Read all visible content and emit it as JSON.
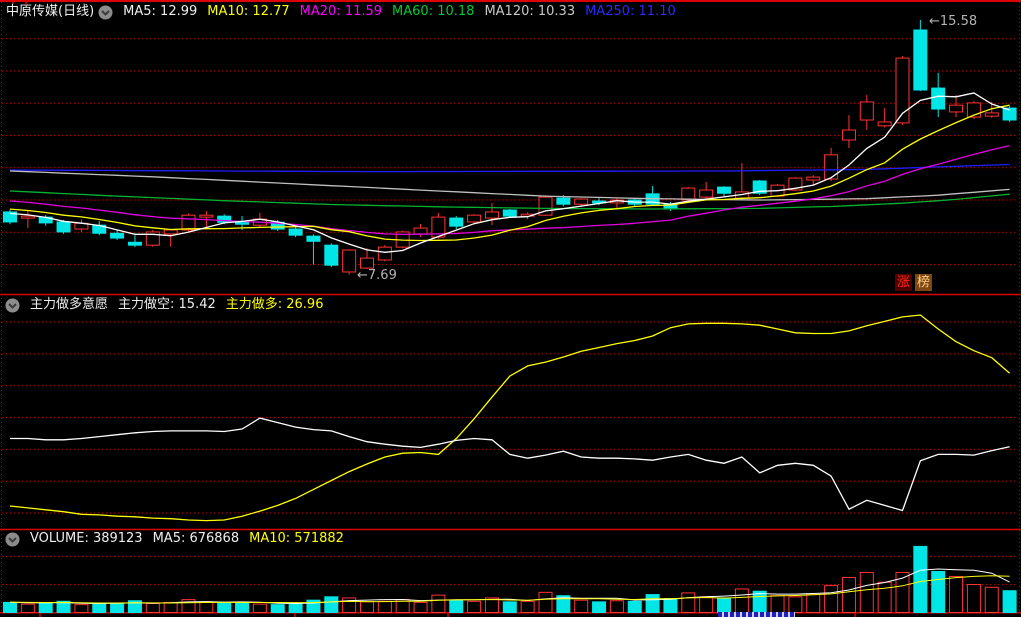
{
  "header": {
    "title": "中原传媒(日线)",
    "ma_items": [
      {
        "text": "MA5: 12.99",
        "color": "#eeeeee"
      },
      {
        "text": "MA10: 12.77",
        "color": "#ffff00"
      },
      {
        "text": "MA20: 11.59",
        "color": "#ff00ff"
      },
      {
        "text": "MA60: 10.18",
        "color": "#00c838"
      },
      {
        "text": "MA120: 10.33",
        "color": "#c8c8c8"
      },
      {
        "text": "MA250: 11.10",
        "color": "#2b2bff"
      }
    ]
  },
  "indicator_header": {
    "title": "主力做多意愿",
    "kong_text": "主力做空: 15.42",
    "duo_text": "主力做多: 26.96"
  },
  "volume_header": {
    "vol_text": "VOLUME: 389123",
    "ma5_text": "MA5: 676868",
    "ma10_text": "MA10: 571882"
  },
  "badges": [
    {
      "label": "涨",
      "bg": "#500000",
      "fg": "#ff2814"
    },
    {
      "label": "榜",
      "bg": "#7d4612",
      "fg": "#ffcc80"
    }
  ],
  "annotations": {
    "high_text": "←15.58",
    "low_text": "←7.69"
  },
  "colors": {
    "up": "#ff3232",
    "down": "#00e6e6",
    "ma5": "#ffffff",
    "ma10": "#ffff00",
    "ma20": "#e100e1",
    "ma60": "#00b432",
    "ma120": "#c0c0c0",
    "ma250": "#1e1eff",
    "grid": "#c80000",
    "frame": "#dc0000",
    "date_strip": "#2020bb"
  },
  "chart_data": {
    "type": "candlestick",
    "title": "中原传媒(日线)",
    "panels": {
      "price": {
        "gridline_prices": [
          15,
          14,
          13,
          12,
          11,
          10,
          9,
          8
        ],
        "high_label": 15.58,
        "high_index": 51,
        "low_label": 7.69,
        "low_index": 19,
        "ma_computed_periods": [
          20,
          10,
          5
        ],
        "prehistory_closes": [
          10.45,
          10.4,
          10.36,
          10.3,
          10.26,
          10.2,
          10.15,
          10.1,
          10.05,
          10.0,
          9.95,
          9.9,
          9.86,
          9.8,
          9.76,
          9.72,
          9.68,
          9.62,
          9.58
        ],
        "ma250_keypoints": [
          [
            0,
            10.93
          ],
          [
            20,
            10.88
          ],
          [
            40,
            10.9
          ],
          [
            48,
            10.95
          ],
          [
            56,
            11.1
          ]
        ],
        "ma120_keypoints": [
          [
            0,
            10.9
          ],
          [
            8,
            10.72
          ],
          [
            16,
            10.5
          ],
          [
            24,
            10.28
          ],
          [
            30,
            10.12
          ],
          [
            36,
            10.04
          ],
          [
            42,
            10.0
          ],
          [
            48,
            10.04
          ],
          [
            52,
            10.15
          ],
          [
            56,
            10.33
          ]
        ],
        "ma60_keypoints": [
          [
            0,
            10.28
          ],
          [
            6,
            10.12
          ],
          [
            12,
            9.98
          ],
          [
            18,
            9.86
          ],
          [
            24,
            9.79
          ],
          [
            30,
            9.74
          ],
          [
            36,
            9.72
          ],
          [
            42,
            9.74
          ],
          [
            46,
            9.8
          ],
          [
            50,
            9.9
          ],
          [
            53,
            10.02
          ],
          [
            56,
            10.18
          ]
        ],
        "ohlc": [
          [
            9.63,
            9.7,
            9.25,
            9.32
          ],
          [
            9.44,
            9.69,
            9.13,
            9.5
          ],
          [
            9.47,
            9.53,
            9.2,
            9.29
          ],
          [
            9.32,
            9.38,
            8.95,
            9.01
          ],
          [
            9.1,
            9.4,
            9.0,
            9.28
          ],
          [
            9.22,
            9.35,
            8.91,
            8.97
          ],
          [
            8.97,
            9.07,
            8.76,
            8.82
          ],
          [
            8.69,
            8.91,
            8.54,
            8.6
          ],
          [
            8.6,
            9.07,
            8.55,
            9.01
          ],
          [
            8.95,
            9.1,
            8.55,
            9.07
          ],
          [
            9.07,
            9.58,
            9.03,
            9.53
          ],
          [
            9.47,
            9.66,
            9.13,
            9.53
          ],
          [
            9.5,
            9.56,
            9.25,
            9.31
          ],
          [
            9.34,
            9.5,
            9.07,
            9.25
          ],
          [
            9.22,
            9.6,
            9.16,
            9.41
          ],
          [
            9.31,
            9.38,
            9.04,
            9.1
          ],
          [
            9.1,
            9.16,
            8.85,
            8.91
          ],
          [
            8.88,
            8.94,
            8.0,
            8.72
          ],
          [
            8.6,
            8.66,
            7.92,
            7.98
          ],
          [
            7.77,
            8.48,
            7.69,
            8.45
          ],
          [
            7.89,
            8.51,
            7.86,
            8.2
          ],
          [
            8.14,
            8.6,
            8.1,
            8.54
          ],
          [
            8.54,
            9.05,
            8.5,
            9.01
          ],
          [
            8.95,
            9.26,
            8.85,
            9.13
          ],
          [
            8.85,
            9.6,
            8.8,
            9.47
          ],
          [
            9.44,
            9.5,
            9.1,
            9.19
          ],
          [
            9.32,
            9.56,
            9.25,
            9.53
          ],
          [
            9.44,
            9.91,
            9.22,
            9.63
          ],
          [
            9.69,
            9.72,
            9.45,
            9.5
          ],
          [
            9.5,
            9.62,
            9.4,
            9.56
          ],
          [
            9.53,
            10.15,
            9.5,
            10.09
          ],
          [
            10.06,
            10.15,
            9.81,
            9.87
          ],
          [
            9.87,
            10.06,
            9.78,
            10.03
          ],
          [
            9.97,
            10.09,
            9.84,
            9.91
          ],
          [
            9.91,
            10.06,
            9.72,
            10.0
          ],
          [
            10.0,
            10.06,
            9.81,
            9.87
          ],
          [
            10.19,
            10.43,
            9.81,
            9.87
          ],
          [
            9.87,
            9.94,
            9.66,
            9.72
          ],
          [
            10.0,
            10.4,
            9.94,
            10.37
          ],
          [
            10.09,
            10.56,
            10.03,
            10.31
          ],
          [
            10.4,
            10.43,
            10.12,
            10.21
          ],
          [
            10.06,
            11.15,
            10.0,
            10.25
          ],
          [
            10.59,
            10.62,
            10.15,
            10.21
          ],
          [
            10.12,
            10.5,
            10.09,
            10.46
          ],
          [
            10.31,
            10.71,
            10.28,
            10.68
          ],
          [
            10.62,
            10.77,
            10.45,
            10.71
          ],
          [
            10.65,
            11.62,
            10.59,
            11.4
          ],
          [
            11.86,
            12.63,
            11.61,
            12.17
          ],
          [
            12.48,
            13.26,
            12.17,
            13.04
          ],
          [
            12.3,
            12.85,
            12.25,
            12.42
          ],
          [
            12.39,
            14.46,
            12.33,
            14.4
          ],
          [
            15.27,
            15.58,
            13.38,
            13.41
          ],
          [
            13.47,
            13.94,
            12.57,
            12.82
          ],
          [
            12.73,
            13.26,
            12.57,
            12.94
          ],
          [
            12.57,
            13.07,
            12.51,
            13.01
          ],
          [
            12.6,
            13.05,
            12.55,
            12.7
          ],
          [
            12.85,
            12.91,
            12.42,
            12.48
          ]
        ]
      },
      "indicator": {
        "name": "主力做多意愿",
        "gridline_values": [
          35,
          30,
          25,
          20,
          15,
          10,
          5
        ],
        "duo_last": 26.96,
        "kong_last": 15.42,
        "duo": [
          6.1,
          5.8,
          5.5,
          5.2,
          4.8,
          4.7,
          4.5,
          4.4,
          4.2,
          4.1,
          3.9,
          3.8,
          3.9,
          4.5,
          5.3,
          6.2,
          7.3,
          8.7,
          10.1,
          11.5,
          12.7,
          13.8,
          14.4,
          14.5,
          14.2,
          16.7,
          19.8,
          23.2,
          26.5,
          28.1,
          28.7,
          29.5,
          30.4,
          31.0,
          31.6,
          32.1,
          32.8,
          34.1,
          34.7,
          34.8,
          34.8,
          34.7,
          34.5,
          33.9,
          33.3,
          33.2,
          33.2,
          33.6,
          34.4,
          35.1,
          35.8,
          36.1,
          33.9,
          31.9,
          30.5,
          29.4,
          26.96
        ],
        "kong": [
          16.7,
          16.7,
          16.5,
          16.5,
          16.7,
          17.0,
          17.3,
          17.6,
          17.8,
          17.9,
          17.9,
          17.9,
          17.8,
          18.2,
          19.9,
          19.2,
          18.5,
          18.1,
          17.9,
          17.0,
          16.2,
          15.8,
          15.5,
          15.3,
          15.8,
          16.4,
          16.7,
          16.5,
          14.2,
          13.6,
          14.1,
          14.7,
          13.8,
          13.6,
          13.6,
          13.5,
          13.3,
          13.8,
          14.2,
          13.3,
          12.8,
          13.8,
          11.3,
          12.5,
          12.8,
          12.5,
          10.8,
          5.6,
          7.0,
          6.2,
          5.4,
          13.2,
          14.2,
          14.2,
          14.1,
          14.8,
          15.42
        ]
      },
      "volume": {
        "last_value": 389123,
        "gridline_values": [
          1000000,
          500000
        ],
        "ma_computed_periods": [
          5,
          10
        ],
        "prehistory": [
          200000,
          190000,
          180000,
          190000,
          200000,
          180000,
          170000,
          180000,
          190000
        ],
        "values": [
          180000,
          150000,
          160000,
          200000,
          140000,
          150000,
          170000,
          210000,
          160000,
          180000,
          230000,
          190000,
          170000,
          180000,
          150000,
          140000,
          160000,
          220000,
          280000,
          260000,
          190000,
          200000,
          230000,
          180000,
          310000,
          220000,
          200000,
          260000,
          190000,
          200000,
          360000,
          300000,
          220000,
          190000,
          210000,
          200000,
          320000,
          250000,
          350000,
          280000,
          260000,
          420000,
          380000,
          300000,
          280000,
          320000,
          480000,
          625000,
          715000,
          540000,
          715000,
          1180000,
          732000,
          643000,
          500000,
          450000,
          389123
        ]
      }
    }
  }
}
